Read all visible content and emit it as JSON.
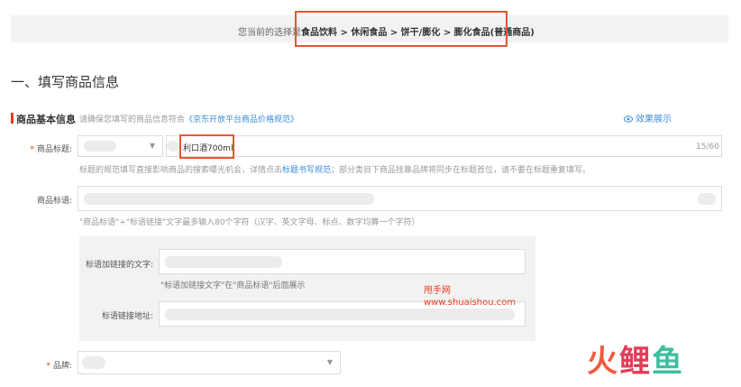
{
  "breadcrumb": {
    "prefix": "您当前的选择是:",
    "path": "食品饮料 > 休闲食品 > 饼干/膨化 > 膨化食品(普通商品)"
  },
  "section": {
    "title": "一、填写商品信息"
  },
  "basic_info": {
    "title": "商品基本信息",
    "tip_prefix": "请确保您填写的商品信息符合",
    "tip_link": "《京东开放平台商品价格规范》",
    "preview_label": "效果展示"
  },
  "product_title": {
    "required_mark": "*",
    "label": "商品标题:",
    "value": "利口酒700ml",
    "counter": "15/60",
    "hint_before": "标题的规范填写直接影响商品的搜索曝光机会，详情点击",
    "hint_link": "标题书写规范",
    "hint_after": "；部分类目下商品挂靠品牌将同步在标题首位，请不要在标题重复填写。"
  },
  "product_slogan": {
    "label": "商品标语:",
    "hint": "\"商品标语\"+\"标语链接\"文字最多输入80个字符（汉字、英文字母、标点、数字均算一个字符）"
  },
  "slogan_link": {
    "text_label": "标语加链接的文字:",
    "text_hint": "\"标语加链接文字\"在\"商品标语\"后面展示",
    "url_label": "标语链接地址:"
  },
  "watermark": {
    "site_name": "甩手网",
    "site_url": "www.shuaishou.com"
  },
  "brand": {
    "required_mark": "*",
    "label": "品牌:"
  },
  "logo": {
    "char1": "火",
    "char2": "鲤",
    "char3": "鱼"
  },
  "colors": {
    "highlight": "#e3562f",
    "link": "#3b8cdb",
    "required": "#e33c1e"
  }
}
